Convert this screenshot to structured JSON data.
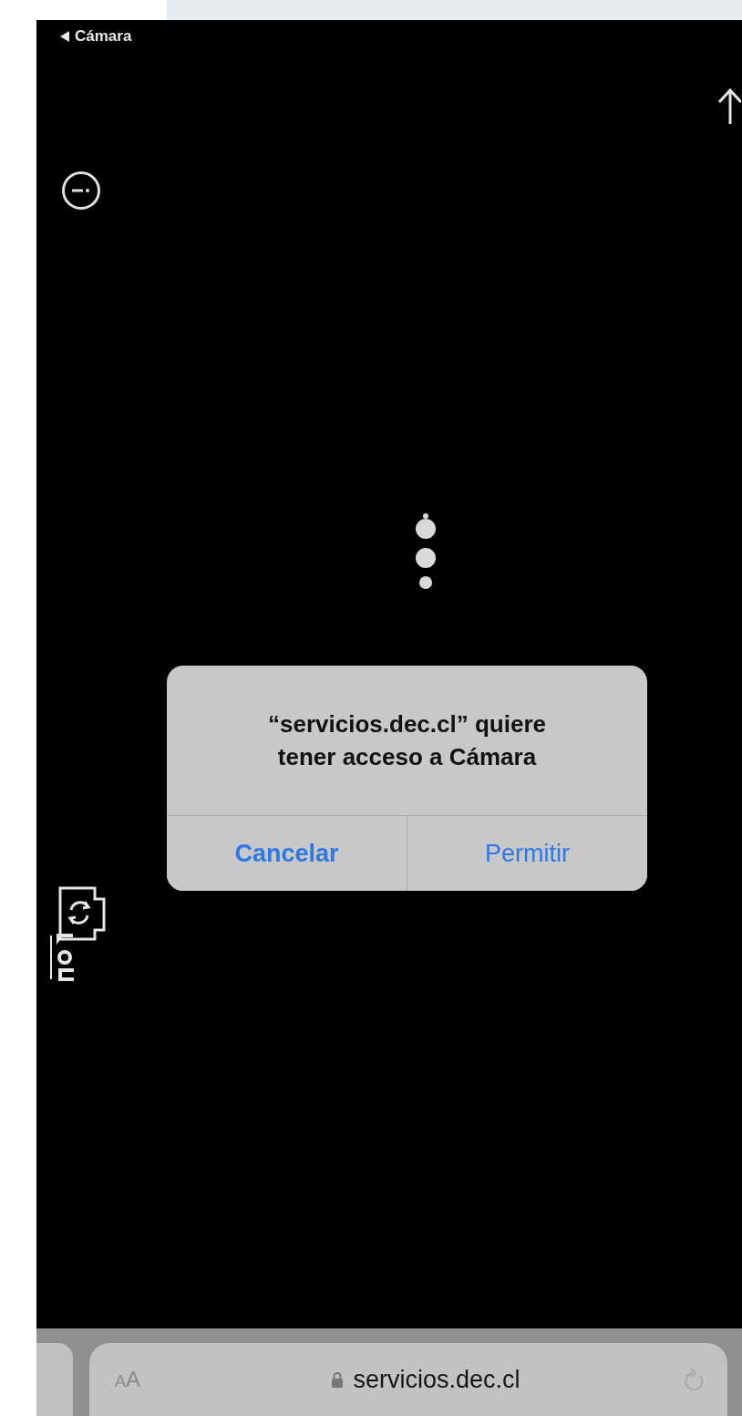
{
  "status_bar": {
    "back_label": "Cámara"
  },
  "alert": {
    "message": "“servicios.dec.cl” quiere tener acceso a Cámara",
    "buttons": [
      {
        "label": "Cancelar",
        "kind": "cancel"
      },
      {
        "label": "Permitir",
        "kind": "default"
      }
    ]
  },
  "address_bar": {
    "text_size_label": "AA",
    "url": "servicios.dec.cl"
  }
}
